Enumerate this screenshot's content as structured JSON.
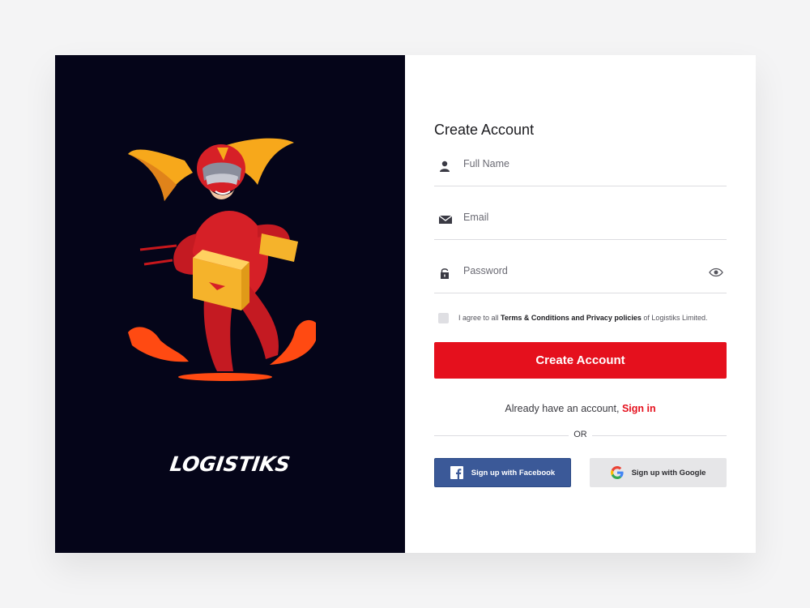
{
  "brand": {
    "logo_text": "LOGISTIKS"
  },
  "form": {
    "title": "Create Account",
    "full_name_placeholder": "Full Name",
    "email_placeholder": "Email",
    "password_placeholder": "Password",
    "agree": {
      "prefix": "I agree to all ",
      "bold": "Terms & Conditions and Privacy policies",
      "suffix": " of Logistiks Limited.",
      "checked": false
    },
    "submit_label": "Create Account",
    "already_text": "Already have an account, ",
    "signin_label": "Sign in",
    "or_text": "OR",
    "facebook_label": "Sign up with Facebook",
    "google_label": "Sign up with Google"
  },
  "icons": {
    "full_name": "user-icon",
    "email": "envelope-icon",
    "password": "lock-icon",
    "show_password": "eye-icon",
    "facebook": "facebook-icon",
    "google": "google-icon"
  },
  "colors": {
    "accent": "#e5101d",
    "left_panel": "#050519",
    "facebook": "#3b5998",
    "google_button": "#e6e6e8"
  }
}
